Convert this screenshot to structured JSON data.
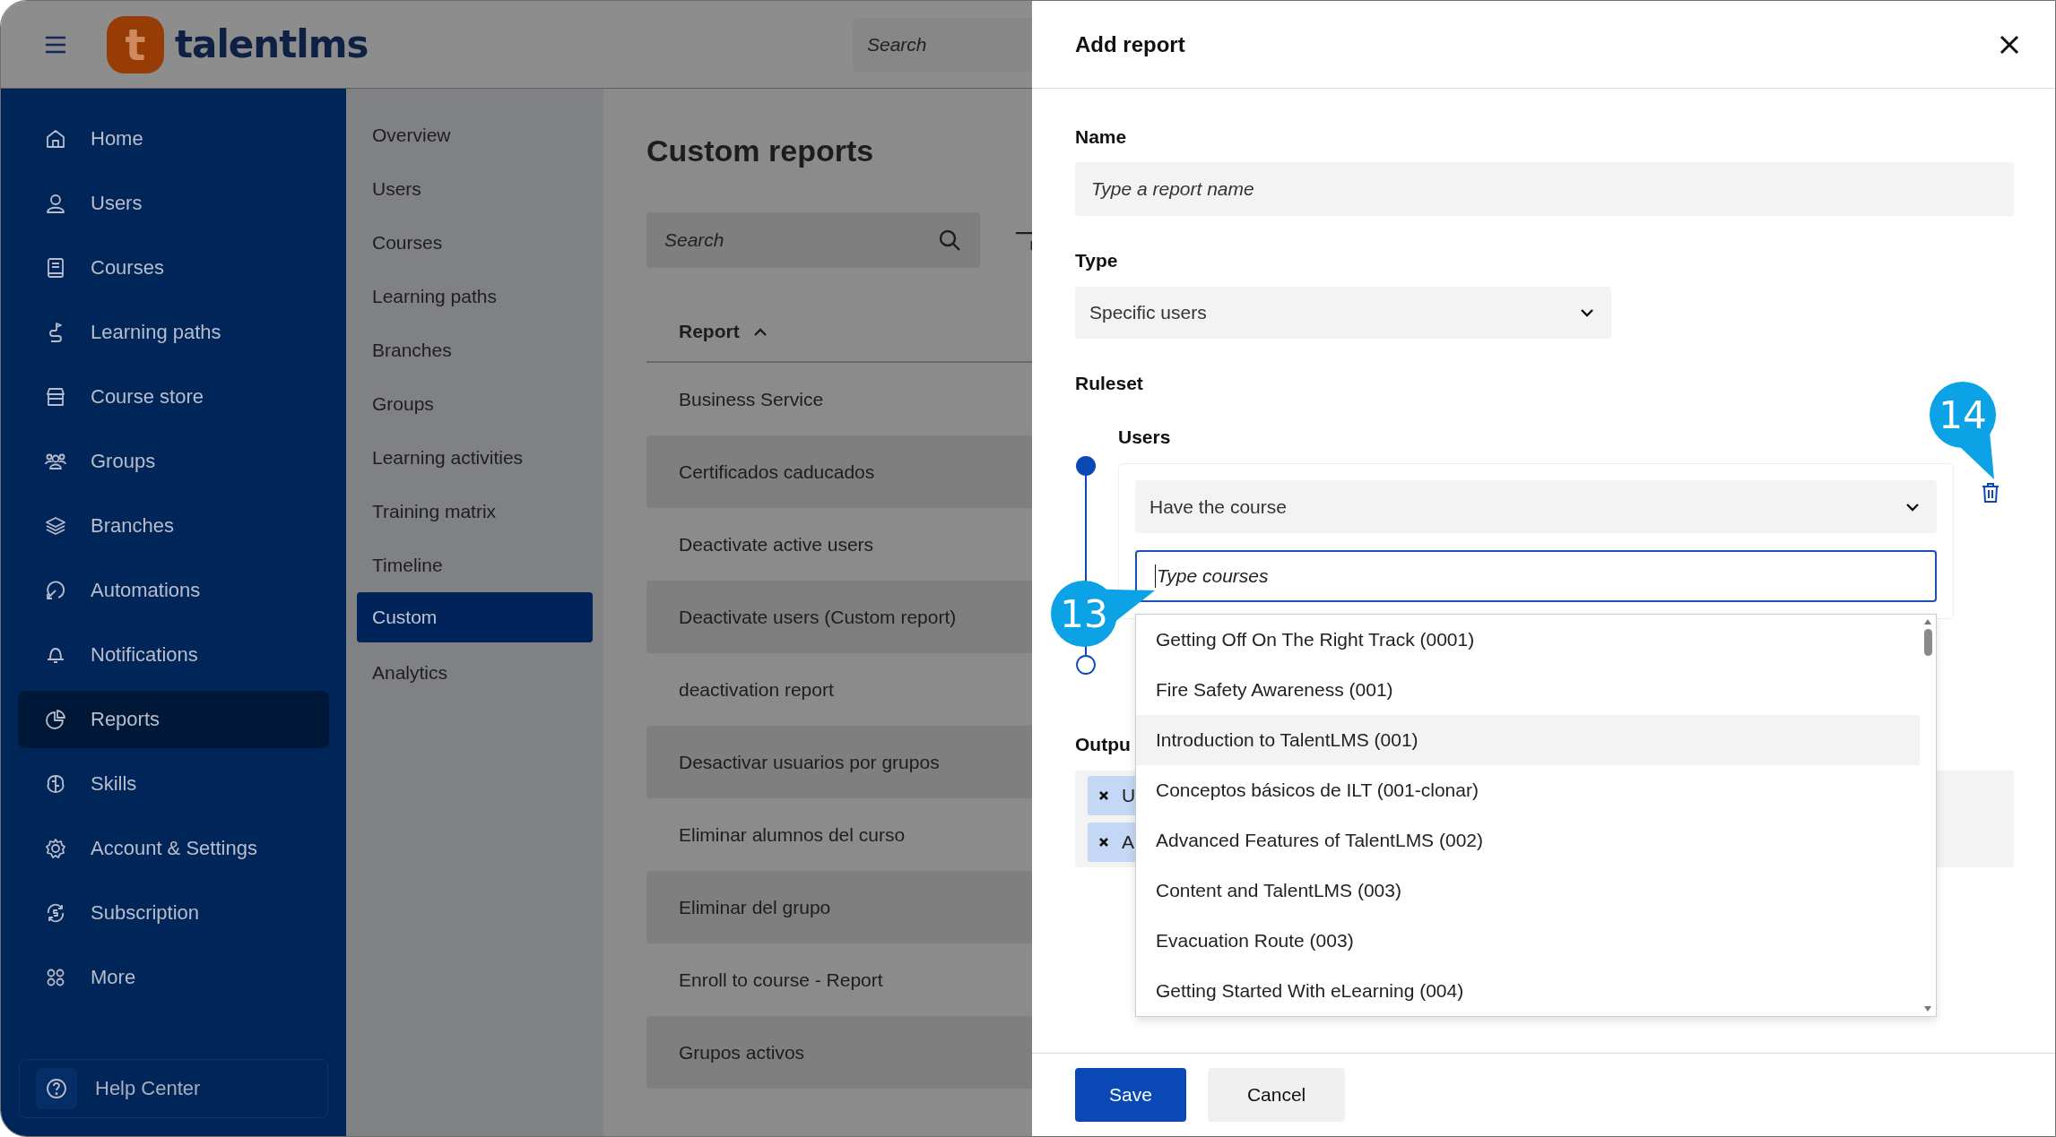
{
  "header": {
    "logo": {
      "mark": "t",
      "text": "talentlms"
    },
    "search": {
      "placeholder": "Search"
    }
  },
  "sidebar": {
    "items": [
      {
        "label": "Home",
        "selected": false
      },
      {
        "label": "Users",
        "selected": false
      },
      {
        "label": "Courses",
        "selected": false
      },
      {
        "label": "Learning paths",
        "selected": false
      },
      {
        "label": "Course store",
        "selected": false
      },
      {
        "label": "Groups",
        "selected": false
      },
      {
        "label": "Branches",
        "selected": false
      },
      {
        "label": "Automations",
        "selected": false
      },
      {
        "label": "Notifications",
        "selected": false
      },
      {
        "label": "Reports",
        "selected": true
      },
      {
        "label": "Skills",
        "selected": false
      },
      {
        "label": "Account & Settings",
        "selected": false
      },
      {
        "label": "Subscription",
        "selected": false
      },
      {
        "label": "More",
        "selected": false
      }
    ],
    "help": {
      "label": "Help Center"
    }
  },
  "subnav": {
    "items": [
      {
        "label": "Overview",
        "selected": false
      },
      {
        "label": "Users",
        "selected": false
      },
      {
        "label": "Courses",
        "selected": false
      },
      {
        "label": "Learning paths",
        "selected": false
      },
      {
        "label": "Branches",
        "selected": false
      },
      {
        "label": "Groups",
        "selected": false
      },
      {
        "label": "Learning activities",
        "selected": false
      },
      {
        "label": "Training matrix",
        "selected": false
      },
      {
        "label": "Timeline",
        "selected": false
      },
      {
        "label": "Custom",
        "selected": true
      },
      {
        "label": "Analytics",
        "selected": false
      }
    ]
  },
  "main": {
    "title": "Custom reports",
    "search": {
      "placeholder": "Search"
    },
    "table": {
      "columns": [
        {
          "label": "Report"
        }
      ],
      "rows": [
        {
          "report": "Business Service"
        },
        {
          "report": "Certificados caducados"
        },
        {
          "report": "Deactivate active users"
        },
        {
          "report": "Deactivate users (Custom report)"
        },
        {
          "report": "deactivation report"
        },
        {
          "report": "Desactivar usuarios por grupos"
        },
        {
          "report": "Eliminar alumnos del curso"
        },
        {
          "report": "Eliminar del grupo"
        },
        {
          "report": "Enroll to course - Report"
        },
        {
          "report": "Grupos activos"
        }
      ]
    }
  },
  "drawer": {
    "title": "Add report",
    "name": {
      "label": "Name",
      "placeholder": "Type a report name"
    },
    "type": {
      "label": "Type",
      "value": "Specific users"
    },
    "ruleset": {
      "label": "Ruleset",
      "rule": {
        "label": "Users",
        "condition": "Have the course",
        "input": {
          "placeholder": "Type courses"
        }
      },
      "dropdown": {
        "items": [
          {
            "label": "Getting Off On The Right Track (0001)",
            "highlighted": false
          },
          {
            "label": "Fire Safety Awareness (001)",
            "highlighted": false
          },
          {
            "label": "Introduction to TalentLMS (001)",
            "highlighted": true
          },
          {
            "label": "Conceptos básicos de ILT (001-clonar)",
            "highlighted": false
          },
          {
            "label": "Advanced Features of TalentLMS (002)",
            "highlighted": false
          },
          {
            "label": "Content and TalentLMS (003)",
            "highlighted": false
          },
          {
            "label": "Evacuation Route (003)",
            "highlighted": false
          },
          {
            "label": "Getting Started With eLearning (004)",
            "highlighted": false
          }
        ]
      }
    },
    "output": {
      "label": "Outpu",
      "tags": [
        {
          "label": "U"
        },
        {
          "label": "A"
        }
      ]
    },
    "buttons": [
      {
        "label": "Save",
        "kind": "primary"
      },
      {
        "label": "Cancel",
        "kind": "secondary"
      }
    ]
  },
  "callouts": [
    {
      "label": "13"
    },
    {
      "label": "14"
    }
  ]
}
